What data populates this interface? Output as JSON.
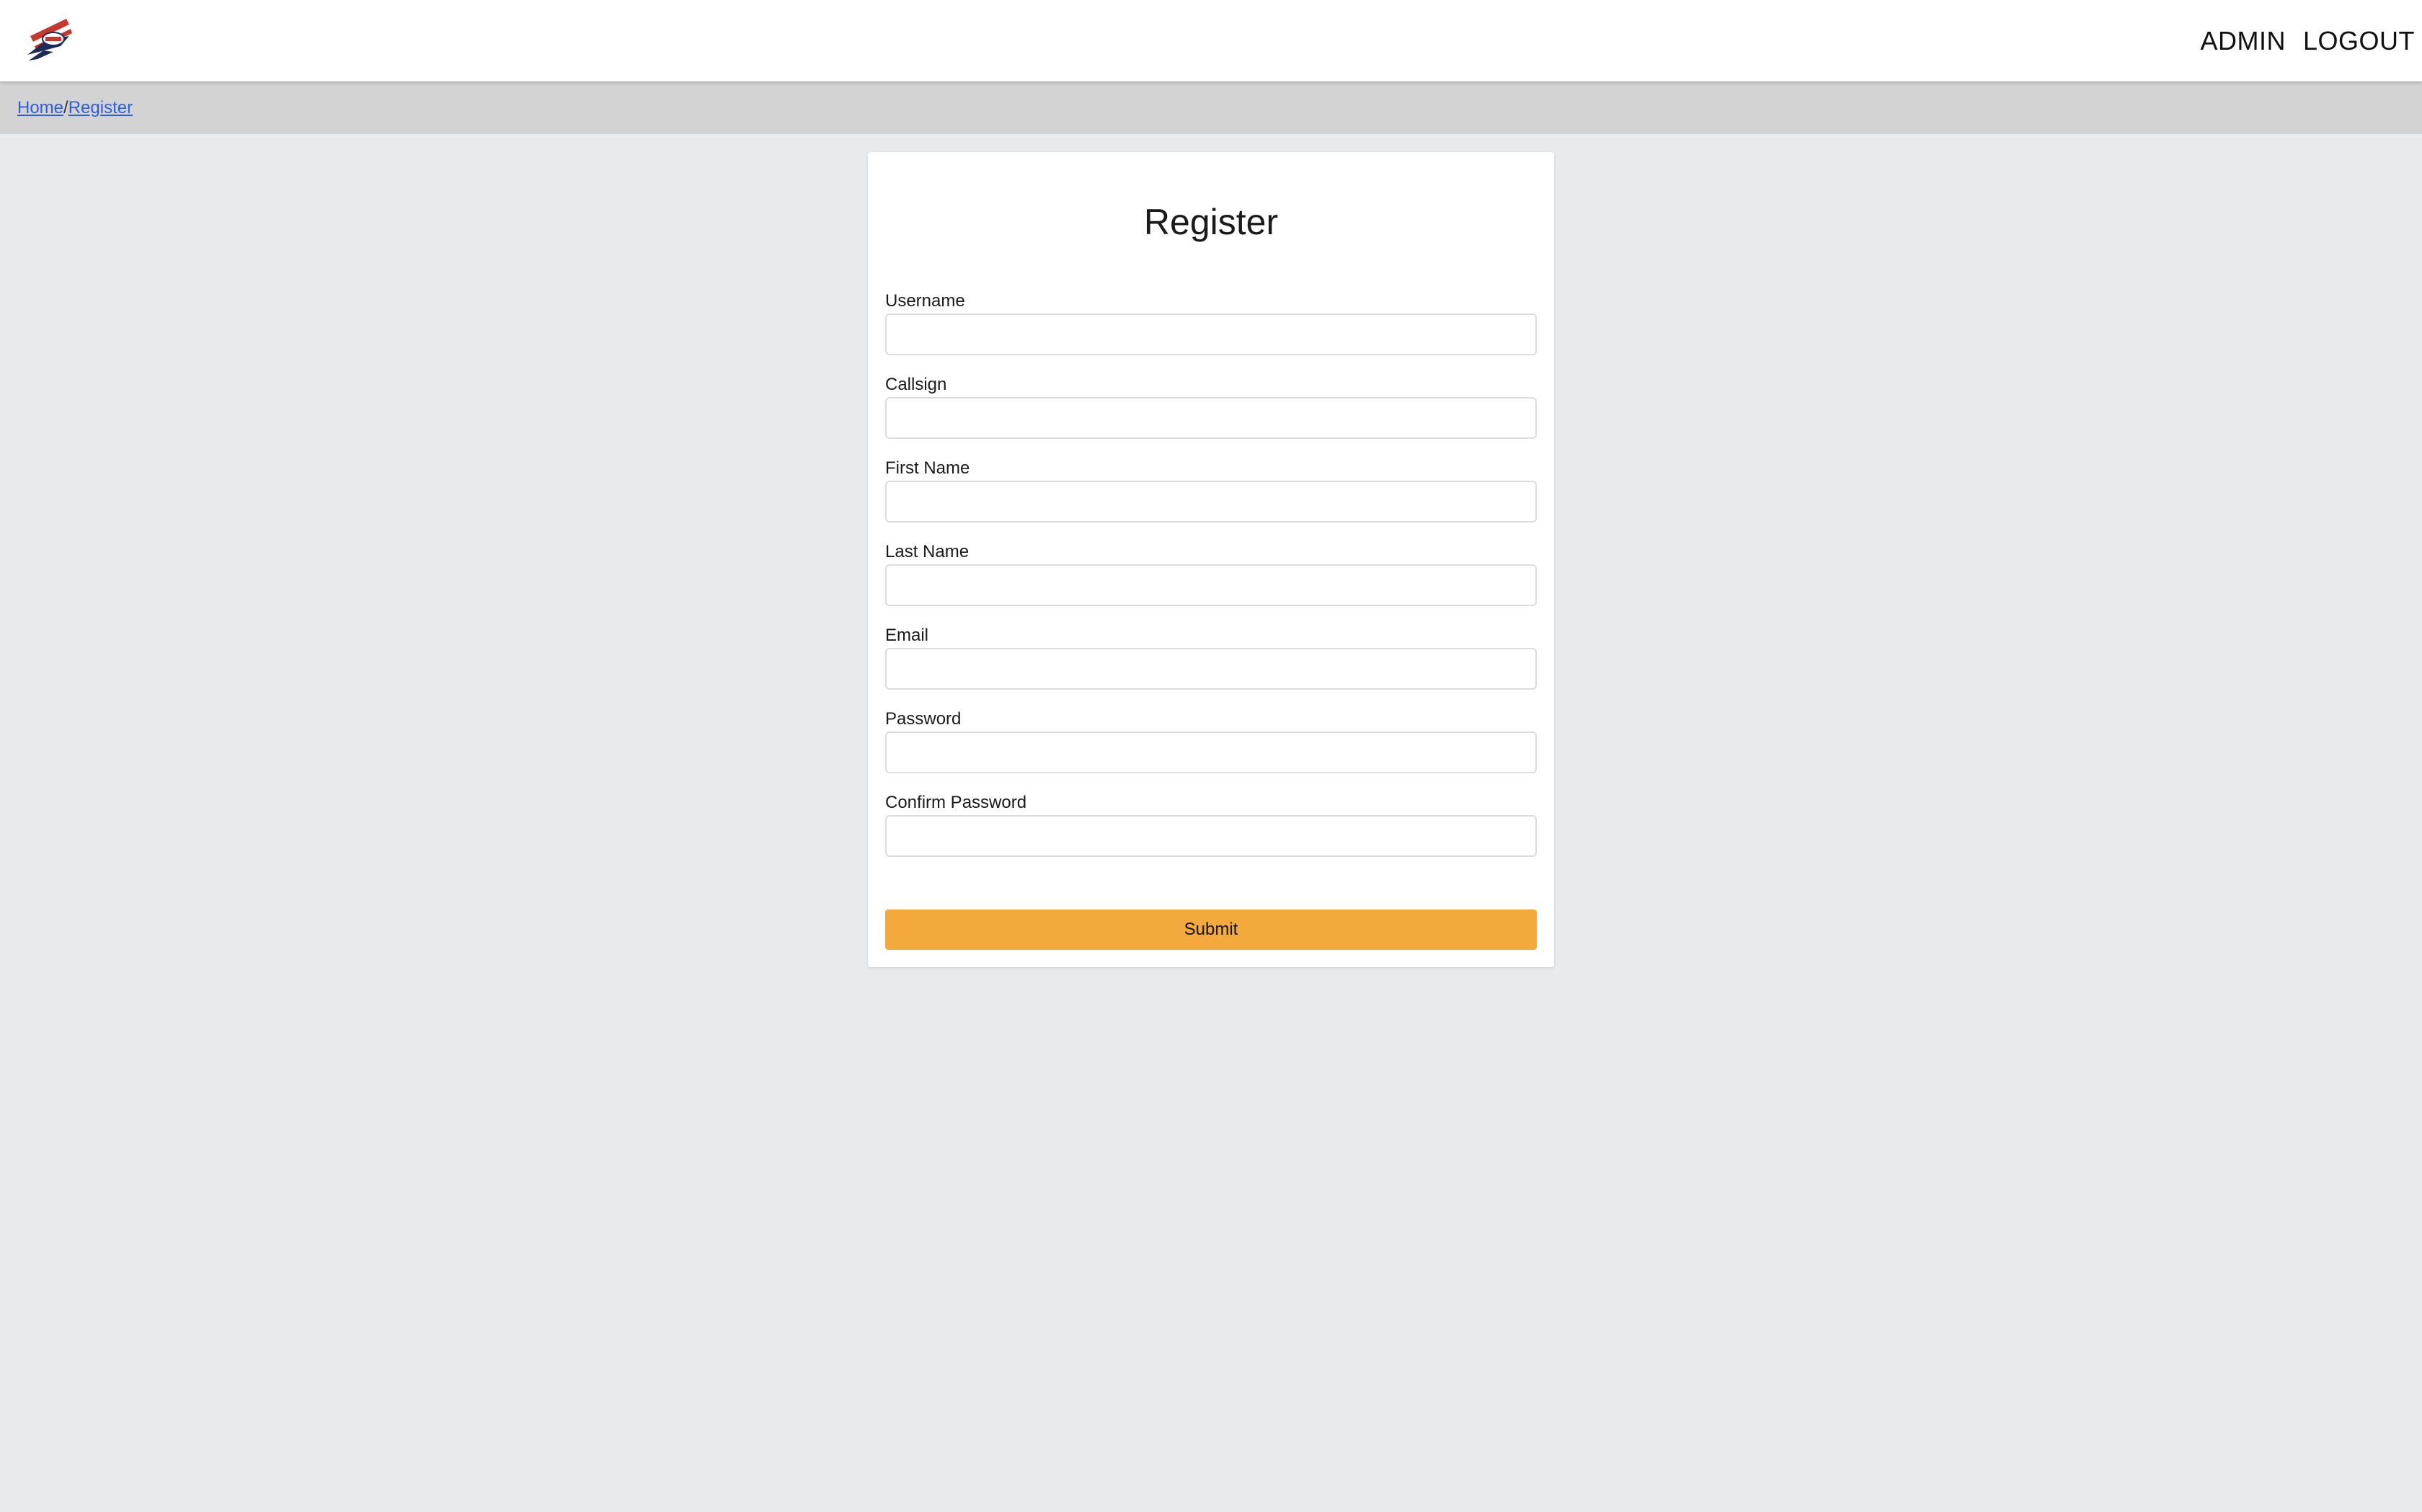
{
  "header": {
    "logo_icon": "squadron-emblem-icon",
    "nav": {
      "admin_label": "ADMIN",
      "logout_label": "LOGOUT"
    }
  },
  "breadcrumb": {
    "home_label": "Home",
    "separator": "/",
    "current_label": "Register"
  },
  "form": {
    "title": "Register",
    "fields": [
      {
        "label": "Username",
        "value": "",
        "type": "text"
      },
      {
        "label": "Callsign",
        "value": "",
        "type": "text"
      },
      {
        "label": "First Name",
        "value": "",
        "type": "text"
      },
      {
        "label": "Last Name",
        "value": "",
        "type": "text"
      },
      {
        "label": "Email",
        "value": "",
        "type": "email"
      },
      {
        "label": "Password",
        "value": "",
        "type": "password"
      },
      {
        "label": "Confirm Password",
        "value": "",
        "type": "password"
      }
    ],
    "submit_label": "Submit"
  },
  "colors": {
    "page_background": "#e8ebee",
    "breadcrumb_background": "#d3d3d3",
    "link": "#2f5fd6",
    "submit_button": "#f3a93c"
  }
}
